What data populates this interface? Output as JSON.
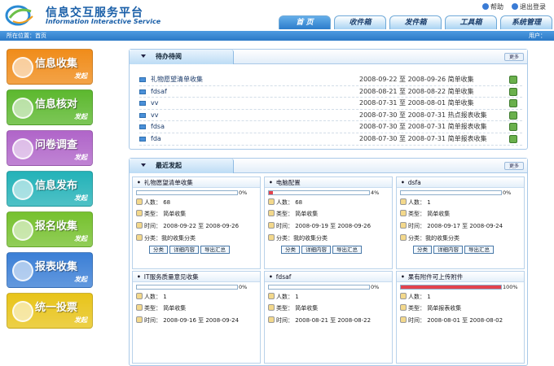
{
  "header": {
    "title_cn": "信息交互服务平台",
    "title_en": "Information Interactive Service",
    "help": "帮助",
    "logout": "退出登录"
  },
  "tabs": [
    "首 页",
    "收件箱",
    "发件箱",
    "工具箱",
    "系统管理"
  ],
  "breadcrumb": {
    "text": "所在位置：首页",
    "user": "用户："
  },
  "sidebar": [
    {
      "label": "信息收集",
      "sub": "发起",
      "color": "#f08c1a"
    },
    {
      "label": "信息核对",
      "sub": "发起",
      "color": "#5cb82e"
    },
    {
      "label": "问卷调查",
      "sub": "发起",
      "color": "#b065c9"
    },
    {
      "label": "信息发布",
      "sub": "发起",
      "color": "#23b2b8"
    },
    {
      "label": "报名收集",
      "sub": "发起",
      "color": "#76c12e"
    },
    {
      "label": "报表收集",
      "sub": "发起",
      "color": "#3b7fd6"
    },
    {
      "label": "统一投票",
      "sub": "发起",
      "color": "#e8c41a"
    }
  ],
  "todo": {
    "title": "待办待阅",
    "more": "更多",
    "rows": [
      {
        "name": "礼物愿望清单收集",
        "date": "2008-09-22 至  2008-09-26 简单收集"
      },
      {
        "name": "fdsaf",
        "date": "2008-08-21 至  2008-08-22 简单收集"
      },
      {
        "name": "vv",
        "date": "2008-07-31 至  2008-08-01 简单收集"
      },
      {
        "name": "vv",
        "date": "2008-07-30 至  2008-07-31 热点报表收集"
      },
      {
        "name": "fdsa",
        "date": "2008-07-30 至  2008-07-31 简单报表收集"
      },
      {
        "name": "fda",
        "date": "2008-07-30 至  2008-07-31 简单报表收集"
      }
    ]
  },
  "recent": {
    "title": "最近发起",
    "more": "更多",
    "cards": [
      {
        "title": "礼物愿望清单收集",
        "progress": 0,
        "pct": "0%",
        "people": "人数：  68",
        "type": "类型：  简单收集",
        "time": "时间：  2008-09-22 至  2008-09-26",
        "cls": "分类：我的收集分类",
        "btns": [
          "分类",
          "详细内容",
          "导出汇总"
        ]
      },
      {
        "title": "电脑配置",
        "progress": 4,
        "pct": "4%",
        "people": "人数：  68",
        "type": "类型：  简单收集",
        "time": "时间：  2008-09-19 至  2008-09-26",
        "cls": "分类：我的收集分类",
        "btns": [
          "分类",
          "详细内容",
          "导出汇总"
        ]
      },
      {
        "title": "dsfa",
        "progress": 0,
        "pct": "0%",
        "people": "人数：  1",
        "type": "类型：  简单收集",
        "time": "时间：  2008-09-17 至  2008-09-24",
        "cls": "分类：我的收集分类",
        "btns": [
          "分类",
          "详细内容",
          "导出汇总"
        ]
      },
      {
        "title": "IT服务质量意见收集",
        "progress": 0,
        "pct": "0%",
        "people": "人数：  1",
        "type": "类型：  简单收集",
        "time": "时间：  2008-09-16 至  2008-09-24",
        "cls": "",
        "btns": []
      },
      {
        "title": "fdsaf",
        "progress": 0,
        "pct": "0%",
        "people": "人数：  1",
        "type": "类型：  简单收集",
        "time": "时间：  2008-08-21 至  2008-08-22",
        "cls": "",
        "btns": []
      },
      {
        "title": "果有附件可上传附件",
        "progress": 100,
        "pct": "100%",
        "people": "人数：  1",
        "type": "类型：  简单报表收集",
        "time": "时间：  2008-08-01 至  2008-08-02",
        "cls": "",
        "btns": []
      }
    ]
  }
}
